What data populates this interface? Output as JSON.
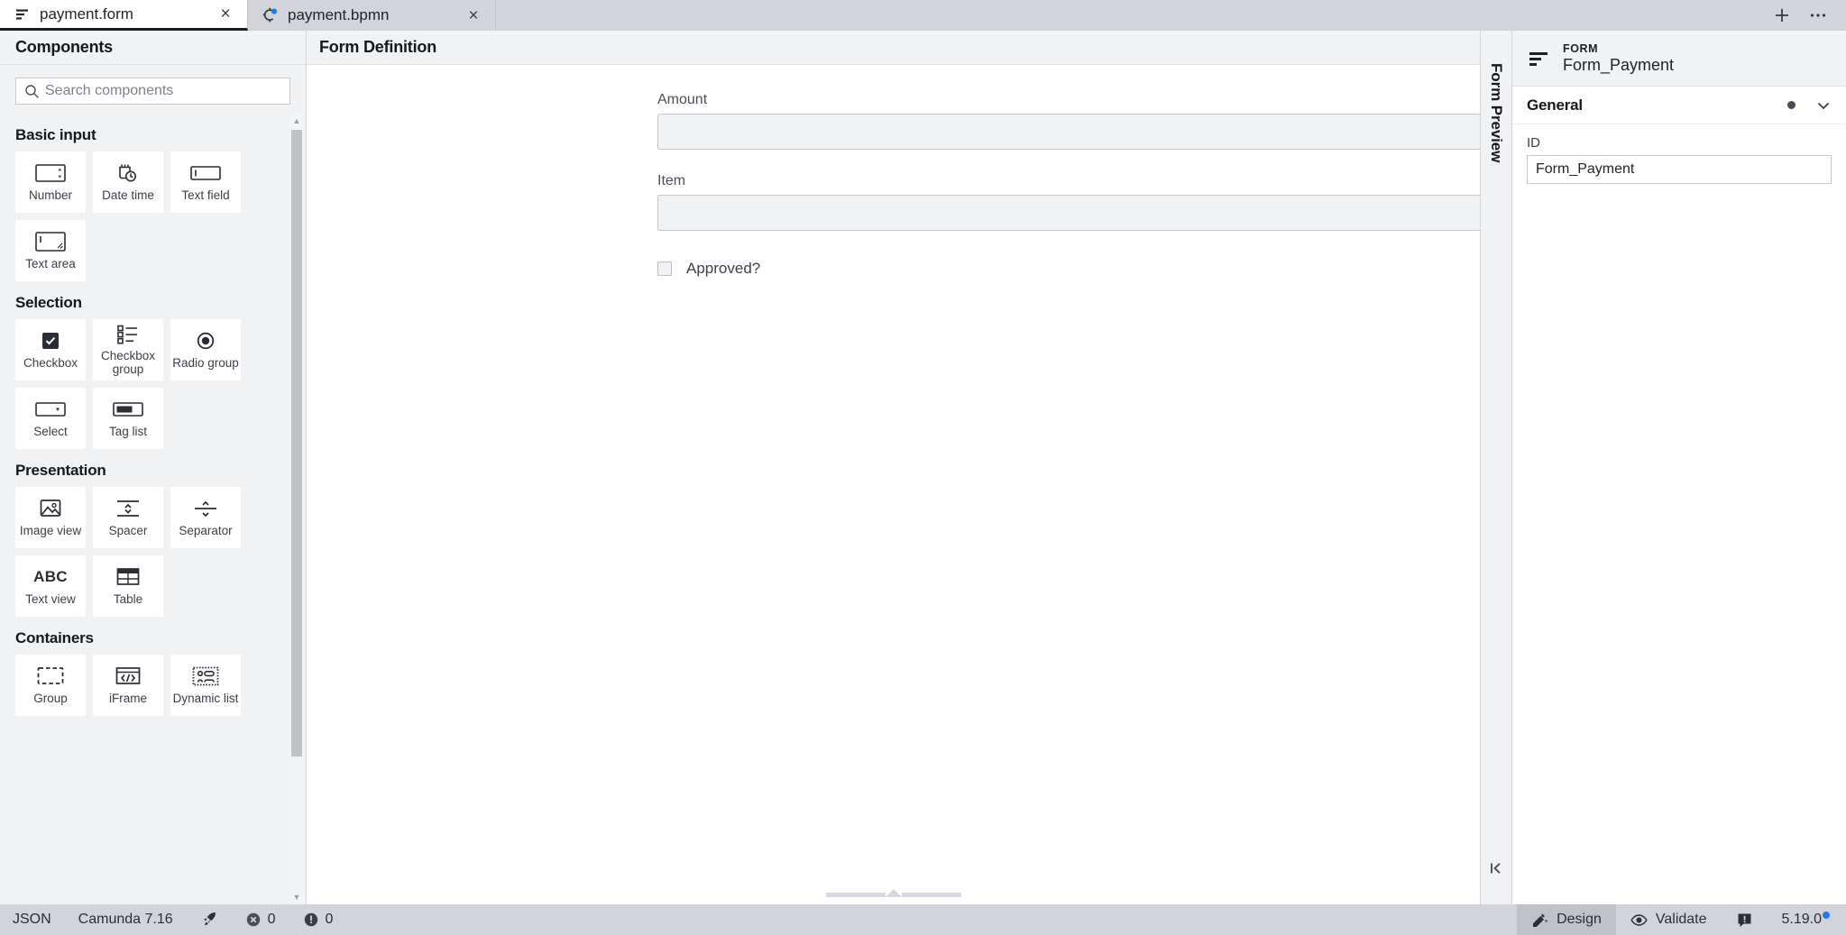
{
  "tabs": [
    {
      "label": "payment.form",
      "icon": "form-icon",
      "active": true,
      "close": "×",
      "dirty": false
    },
    {
      "label": "payment.bpmn",
      "icon": "bpmn-icon",
      "active": false,
      "close": "×",
      "dirty": true
    }
  ],
  "tabbar": {
    "new_tab_label": "+",
    "more_label": "⋯"
  },
  "palette": {
    "title": "Components",
    "search": {
      "value": "",
      "placeholder": "Search components"
    },
    "groups": [
      {
        "title": "Basic input",
        "items": [
          {
            "label": "Number",
            "icon": "number-input-icon"
          },
          {
            "label": "Date time",
            "icon": "calendar-clock-icon"
          },
          {
            "label": "Text field",
            "icon": "text-field-icon"
          },
          {
            "label": "Text area",
            "icon": "text-area-icon"
          }
        ]
      },
      {
        "title": "Selection",
        "items": [
          {
            "label": "Checkbox",
            "icon": "checkbox-icon"
          },
          {
            "label": "Checkbox group",
            "icon": "checkbox-group-icon"
          },
          {
            "label": "Radio group",
            "icon": "radio-group-icon"
          },
          {
            "label": "Select",
            "icon": "select-dropdown-icon"
          },
          {
            "label": "Tag list",
            "icon": "tag-list-icon"
          }
        ]
      },
      {
        "title": "Presentation",
        "items": [
          {
            "label": "Image view",
            "icon": "image-icon"
          },
          {
            "label": "Spacer",
            "icon": "spacer-icon"
          },
          {
            "label": "Separator",
            "icon": "separator-icon"
          },
          {
            "label": "Text view",
            "icon": "abc-text-icon"
          },
          {
            "label": "Table",
            "icon": "table-icon"
          }
        ]
      },
      {
        "title": "Containers",
        "items": [
          {
            "label": "Group",
            "icon": "group-dashed-icon"
          },
          {
            "label": "iFrame",
            "icon": "code-frame-icon"
          },
          {
            "label": "Dynamic list",
            "icon": "dynamic-list-icon"
          }
        ]
      }
    ]
  },
  "editor": {
    "title": "Form Definition",
    "fields": [
      {
        "type": "number",
        "label": "Amount",
        "value": "",
        "name": "amount-field"
      },
      {
        "type": "text",
        "label": "Item",
        "value": "",
        "name": "item-field"
      },
      {
        "type": "checkbox",
        "label": "Approved?",
        "checked": false,
        "name": "approved-field"
      }
    ]
  },
  "preview_rail": {
    "label": "Form Preview",
    "collapse_icon": "collapse-left-icon"
  },
  "properties": {
    "kind": "FORM",
    "name": "Form_Payment",
    "icon": "form-icon",
    "groups": [
      {
        "title": "General",
        "fields": [
          {
            "label": "ID",
            "value": "Form_Payment"
          }
        ]
      }
    ]
  },
  "statusbar": {
    "left": [
      {
        "label": "JSON",
        "icon": null
      },
      {
        "label": "Camunda 7.16",
        "icon": null
      },
      {
        "label": "",
        "icon": "rocket-icon"
      },
      {
        "label": "0",
        "icon": "error-icon"
      },
      {
        "label": "0",
        "icon": "warning-icon"
      }
    ],
    "right": [
      {
        "label": "Design",
        "icon": "design-icon",
        "active": true
      },
      {
        "label": "Validate",
        "icon": "eye-icon",
        "active": false
      }
    ],
    "feedback_icon": "feedback-icon",
    "version": "5.19.0",
    "version_badge_color": "#1e7de8"
  },
  "colors": {
    "chrome": "#d2d4d9",
    "panel": "#f1f2f4",
    "accent": "#1e7de8",
    "border": "#d3d5da",
    "text": "#22242a"
  }
}
